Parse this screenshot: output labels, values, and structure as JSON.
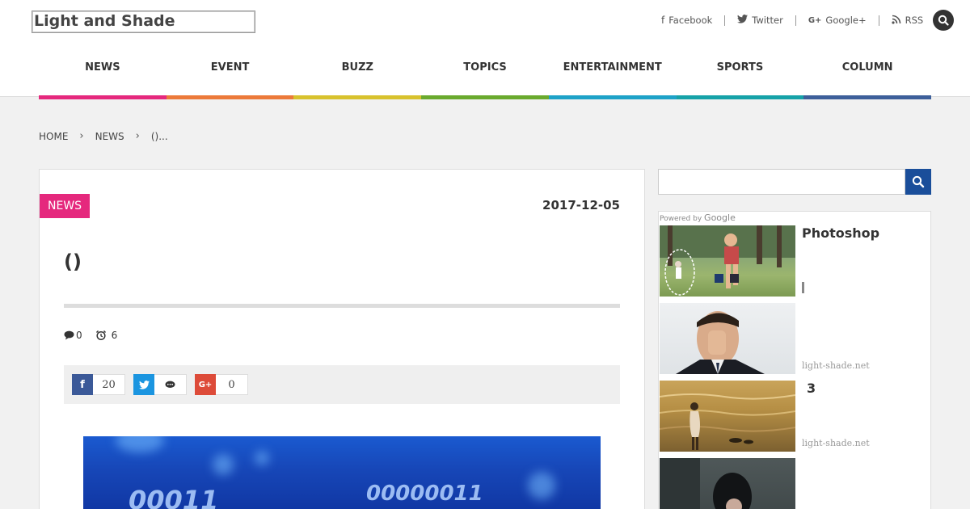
{
  "site": {
    "logo": "Light and Shade"
  },
  "social": [
    {
      "label": "Facebook",
      "icon": "facebook-icon"
    },
    {
      "label": "Twitter",
      "icon": "twitter-icon"
    },
    {
      "label": "Google+",
      "icon": "google-plus-icon"
    },
    {
      "label": "RSS",
      "icon": "rss-icon"
    }
  ],
  "nav": [
    {
      "label": "NEWS",
      "color": "#e5287d"
    },
    {
      "label": "EVENT",
      "color": "#ec7a3a"
    },
    {
      "label": "BUZZ",
      "color": "#d8c22d"
    },
    {
      "label": "TOPICS",
      "color": "#6aaa2e"
    },
    {
      "label": "ENTERTAINMENT",
      "color": "#1ea2c8"
    },
    {
      "label": "SPORTS",
      "color": "#16a2a8"
    },
    {
      "label": "COLUMN",
      "color": "#3d5f9a"
    }
  ],
  "breadcrumb": {
    "home": "HOME",
    "category": "NEWS",
    "current": "()..."
  },
  "article": {
    "category": "NEWS",
    "date": "2017-12-05",
    "title": "()",
    "comments": "0",
    "views": "6",
    "share": {
      "facebook_count": "20",
      "google_count": "0"
    }
  },
  "sidebar": {
    "powered_by": "Powered by",
    "google": "Google",
    "ads": [
      {
        "title": "Photoshop",
        "url": ""
      },
      {
        "title": "",
        "url": "light-shade.net"
      },
      {
        "title": "3",
        "url": "light-shade.net"
      },
      {
        "title": "",
        "url": ""
      }
    ]
  },
  "hero": {
    "bits_left": "00011",
    "bits_right": "00000011"
  },
  "colors": {
    "accent": "#e5287d",
    "search": "#1a4e9a"
  }
}
